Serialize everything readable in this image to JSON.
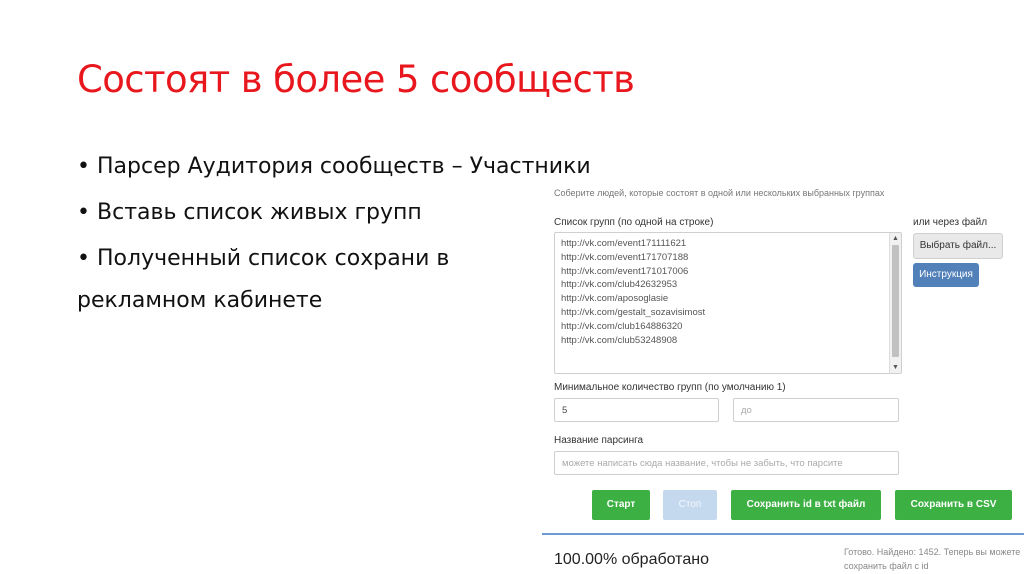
{
  "slide": {
    "title": "Состоят в более 5 сообществ",
    "bullets": [
      "Парсер Аудитория сообществ – Участники",
      "Вставь список живых групп",
      "Полученный список сохрани в"
    ],
    "bullet_continuation": "рекламном кабинете"
  },
  "parser": {
    "hint": "Соберите людей, которые состоят в одной или нескольких выбранных группах",
    "groups_label": "Список групп (по одной на строке)",
    "groups": [
      "http://vk.com/event171111621",
      "http://vk.com/event171707188",
      "http://vk.com/event171017006",
      "http://vk.com/club42632953",
      "http://vk.com/aposoglasie",
      "http://vk.com/gestalt_sozavisimost",
      "http://vk.com/club164886320",
      "http://vk.com/club53248908"
    ],
    "file_label": "или через файл",
    "choose_file": "Выбрать файл...",
    "instructions": "Инструкция",
    "min_groups_label": "Минимальное количество групп (по умолчанию 1)",
    "min_groups_value": "5",
    "max_placeholder": "до",
    "name_label": "Название парсинга",
    "name_placeholder": "можете написать сюда название, чтобы не забыть, что парсите",
    "start": "Старт",
    "stop": "Стоп",
    "save_txt": "Сохранить id в txt файл",
    "save_csv": "Сохранить в CSV",
    "progress": "100.00% обработано",
    "status": "Готово. Найдено: 1452. Теперь вы можете сохранить файл с id"
  },
  "colors": {
    "title": "#e8171d",
    "accent": "#5181b8",
    "success": "#3cb043",
    "disabled": "#c4d8ee"
  }
}
